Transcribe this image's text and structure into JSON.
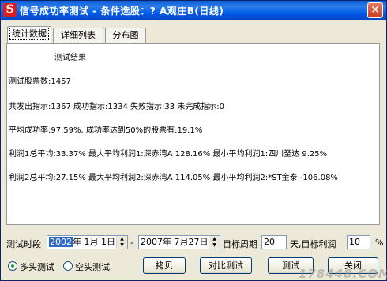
{
  "window": {
    "title": "信号成功率测试 - 条件选股：? A观庄B(日线)",
    "close_glyph": "×"
  },
  "tabs": [
    {
      "label": "统计数据",
      "active": true
    },
    {
      "label": "详细列表",
      "active": false
    },
    {
      "label": "分布图",
      "active": false
    }
  ],
  "results": {
    "heading": "测试结果",
    "lines": [
      "测试股票数:1457",
      "共发出指示:1367 成功指示:1334 失败指示:33 未完成指示:0",
      "平均成功率:97.59%, 成功率达到50%的股票有:19.1%",
      "利润1总平均:33.37% 最大平均利润1:深赤湾A  128.16% 最小平均利润1:四川圣达 9.25%",
      "利润2总平均:27.15% 最大平均利润2:深赤湾A  114.05% 最小平均利润2:*ST金泰 -106.08%"
    ]
  },
  "controls": {
    "period_label": "测试时段",
    "start_year": "2002",
    "start_rest": "年  1月  1日",
    "dash": "-",
    "end_date": "2007年  7月27日",
    "target_period_label": "目标周期",
    "target_period_value": "20",
    "target_profit_label": "天,目标利润",
    "target_profit_value": "10",
    "percent": "%",
    "radio_long": "多头测试",
    "radio_short": "空头测试",
    "btn_copy": "拷贝",
    "btn_compare": "对比测试",
    "btn_test": "测试",
    "btn_close": "关闭"
  },
  "watermark": "178448.COM"
}
